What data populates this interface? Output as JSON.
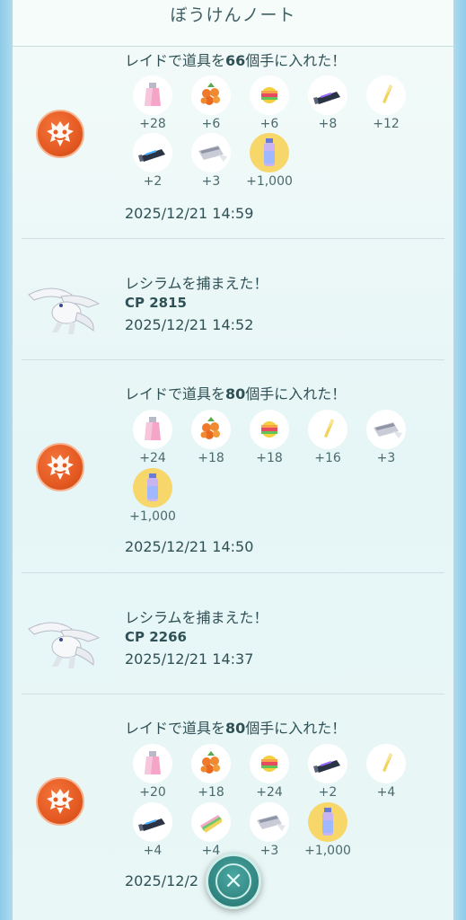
{
  "header": {
    "title": "ぼうけんノート"
  },
  "entries": [
    {
      "type": "raid",
      "title_pre": "レイドで道具を",
      "count": "66",
      "title_post": "個手に入れた！",
      "items": [
        {
          "icon": "potion-icon",
          "qty": "+28"
        },
        {
          "icon": "razz-berry-icon",
          "qty": "+6"
        },
        {
          "icon": "rare-candy-icon",
          "qty": "+6"
        },
        {
          "icon": "technical-machine-icon",
          "qty": "+8"
        },
        {
          "icon": "golden-razz-feather-icon",
          "qty": "+12"
        },
        {
          "icon": "technical-machine-icon",
          "qty": "+2"
        },
        {
          "icon": "raid-pass-icon",
          "qty": "+3"
        },
        {
          "icon": "stardust-bottle-icon",
          "qty": "+1,000"
        }
      ],
      "date": "2025/12/21 14:59"
    },
    {
      "type": "catch",
      "title": "レシラムを捕まえた！",
      "cp_label": "CP",
      "cp": "2815",
      "date": "2025/12/21 14:52"
    },
    {
      "type": "raid",
      "title_pre": "レイドで道具を",
      "count": "80",
      "title_post": "個手に入れた！",
      "items": [
        {
          "icon": "potion-icon",
          "qty": "+24"
        },
        {
          "icon": "razz-berry-icon",
          "qty": "+18"
        },
        {
          "icon": "rare-candy-icon",
          "qty": "+18"
        },
        {
          "icon": "golden-razz-feather-icon",
          "qty": "+16"
        },
        {
          "icon": "raid-pass-icon",
          "qty": "+3"
        },
        {
          "icon": "stardust-bottle-icon",
          "qty": "+1,000"
        }
      ],
      "date": "2025/12/21 14:50"
    },
    {
      "type": "catch",
      "title": "レシラムを捕まえた！",
      "cp_label": "CP",
      "cp": "2266",
      "date": "2025/12/21 14:37"
    },
    {
      "type": "raid",
      "title_pre": "レイドで道具を",
      "count": "80",
      "title_post": "個手に入れた！",
      "items": [
        {
          "icon": "potion-icon",
          "qty": "+20"
        },
        {
          "icon": "razz-berry-icon",
          "qty": "+18"
        },
        {
          "icon": "rare-candy-icon",
          "qty": "+24"
        },
        {
          "icon": "technical-machine-icon",
          "qty": "+2"
        },
        {
          "icon": "golden-razz-feather-icon",
          "qty": "+4"
        },
        {
          "icon": "technical-machine-icon",
          "qty": "+4"
        },
        {
          "icon": "poffin-icon",
          "qty": "+4"
        },
        {
          "icon": "raid-pass-icon",
          "qty": "+3"
        },
        {
          "icon": "stardust-bottle-icon",
          "qty": "+1,000"
        }
      ],
      "date": "2025/12/2"
    }
  ],
  "close_button": {
    "icon": "close-icon",
    "label": "×"
  },
  "colors": {
    "text": "#2f5156",
    "badge": "#e45a22",
    "accent": "#2e7f7c",
    "highlight": "#f7d66a"
  }
}
